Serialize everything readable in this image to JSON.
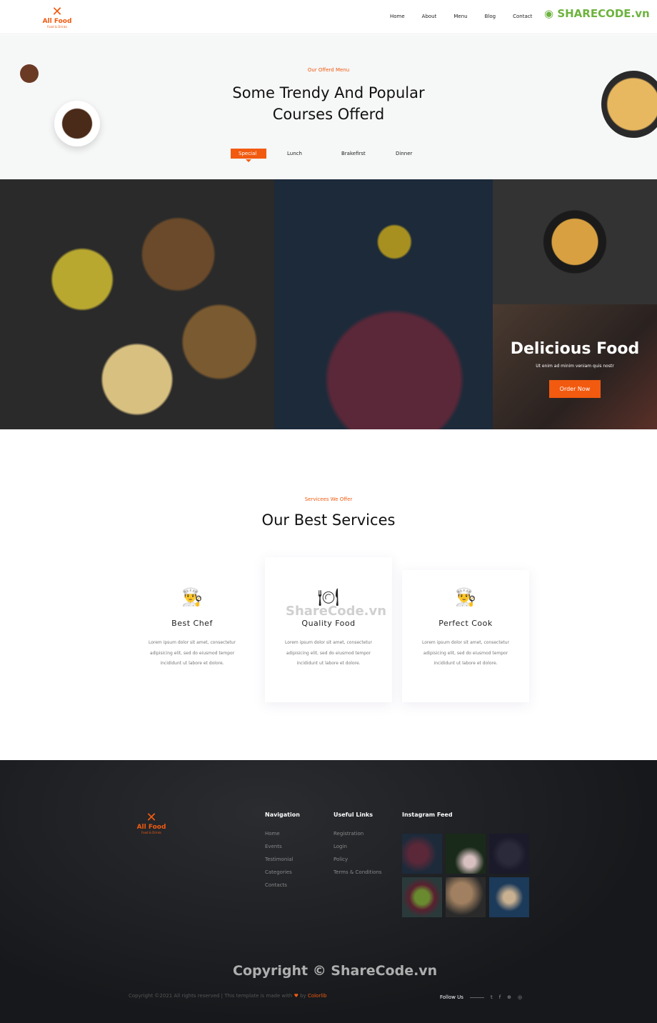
{
  "header": {
    "logo": {
      "name": "All Food",
      "tagline": "Food & Drinks"
    },
    "nav": [
      "Home",
      "About",
      "Menu",
      "Blog",
      "Contact"
    ],
    "watermark_logo": "SHARECODE.vn"
  },
  "menu": {
    "subtitle": "Our Offerd Menu",
    "title_line1": "Some Trendy And Popular",
    "title_line2": "Courses Offerd",
    "tabs": [
      "Special",
      "Lunch",
      "Brakefirst",
      "Dinner"
    ],
    "active_tab": "Special"
  },
  "promo": {
    "title": "Delicious Food",
    "text": "Ut enim ad minim veniam quis nostr",
    "button": "Order Now"
  },
  "services": {
    "subtitle": "Servicees We Offer",
    "title": "Our Best Services",
    "cards": [
      {
        "icon": "chef-icon",
        "title": "Best Chef",
        "text": "Lorem ipsum dolor sit amet, consectetur adipisicing elit, sed do eiusmod tempor incididunt ut labore et dolore."
      },
      {
        "icon": "plate-cutlery-icon",
        "title": "Quality Food",
        "text": "Lorem ipsum dolor sit amet, consectetur adipisicing elit, sed do eiusmod tempor incididunt ut labore et dolore."
      },
      {
        "icon": "chef-icon",
        "title": "Perfect Cook",
        "text": "Lorem ipsum dolor sit amet, consectetur adipisicing elit, sed do eiusmod tempor incididunt ut labore et dolore."
      }
    ],
    "watermark": "ShareCode.vn"
  },
  "footer": {
    "logo": {
      "name": "All Food",
      "tagline": "Food & Drinks"
    },
    "navigation": {
      "title": "Navigation",
      "links": [
        "Home",
        "Events",
        "Testimonial",
        "Categories",
        "Contacts"
      ]
    },
    "useful": {
      "title": "Useful Links",
      "links": [
        "Registration",
        "Login",
        "Policy",
        "Terms & Conditions"
      ]
    },
    "instagram": {
      "title": "Instagram Feed"
    },
    "watermark": "Copyright © ShareCode.vn",
    "copyright": "Copyright ©2021 All rights reserved | This template is made with",
    "by": "by",
    "credit": "Colorlib",
    "follow": "Follow Us"
  },
  "colors": {
    "accent": "#f15a0f",
    "footer_bg": "#1a1c1f"
  }
}
